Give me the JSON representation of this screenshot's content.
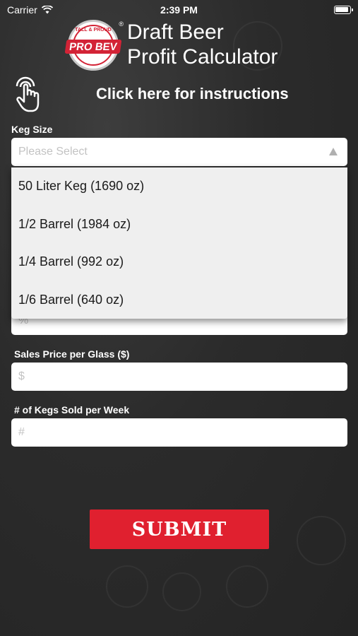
{
  "status_bar": {
    "carrier": "Carrier",
    "time": "2:39 PM"
  },
  "logo": {
    "top_text": "TALL & PROUD",
    "brand": "PRO BEV",
    "registered": "®"
  },
  "header": {
    "title_line1": "Draft Beer",
    "title_line2": "Profit Calculator"
  },
  "instructions": {
    "label": "Click here for instructions",
    "icon": "hand-tap-icon"
  },
  "form": {
    "keg_size": {
      "label": "Keg Size",
      "placeholder": "Please Select",
      "options": [
        "50 Liter Keg (1690 oz)",
        "1/2 Barrel (1984 oz)",
        "1/4 Barrel (992 oz)",
        "1/6 Barrel (640 oz)"
      ]
    },
    "hidden_percent_field": {
      "placeholder": "%"
    },
    "sales_price": {
      "label": "Sales Price per Glass ($)",
      "placeholder": "$"
    },
    "kegs_sold": {
      "label": "# of Kegs Sold per Week",
      "placeholder": "#"
    },
    "submit_label": "SUBMIT"
  },
  "colors": {
    "accent": "#e0202f",
    "background": "#2b2b2b"
  }
}
